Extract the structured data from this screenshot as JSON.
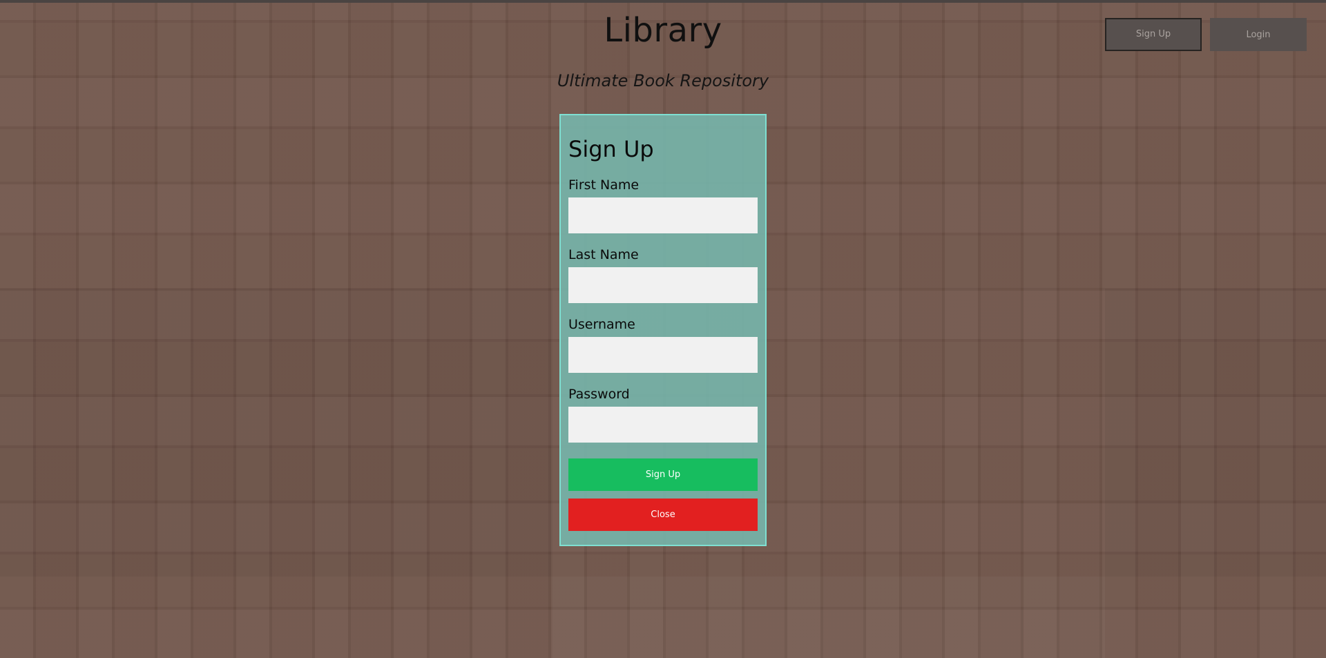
{
  "header": {
    "title": "Library",
    "tagline": "Ultimate Book Repository"
  },
  "nav": {
    "signup_label": "Sign Up",
    "login_label": "Login"
  },
  "signup_form": {
    "title": "Sign Up",
    "fields": [
      {
        "label": "First Name",
        "value": "",
        "placeholder": ""
      },
      {
        "label": "Last Name",
        "value": "",
        "placeholder": ""
      },
      {
        "label": "Username",
        "value": "",
        "placeholder": ""
      },
      {
        "label": "Password",
        "value": "",
        "placeholder": ""
      }
    ],
    "submit_label": "Sign Up",
    "close_label": "Close"
  },
  "colors": {
    "background": "#6e5348",
    "modal_background": "#76b7ad",
    "modal_border": "#7fe0d2",
    "submit_button": "#17bd5f",
    "close_button": "#e22020",
    "nav_button": "#57504e"
  }
}
